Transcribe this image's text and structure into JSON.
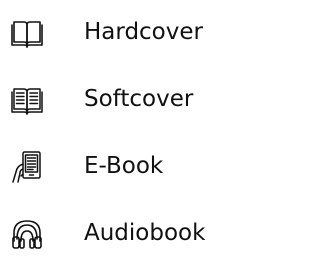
{
  "formats": [
    {
      "label": "Hardcover",
      "icon": "open-book-outline-icon"
    },
    {
      "label": "Softcover",
      "icon": "open-book-pages-icon"
    },
    {
      "label": "E-Book",
      "icon": "ereader-hand-icon"
    },
    {
      "label": "Audiobook",
      "icon": "headphones-icon"
    }
  ],
  "colors": {
    "text": "#111111",
    "icon_stroke": "#111111",
    "background": "#ffffff"
  }
}
